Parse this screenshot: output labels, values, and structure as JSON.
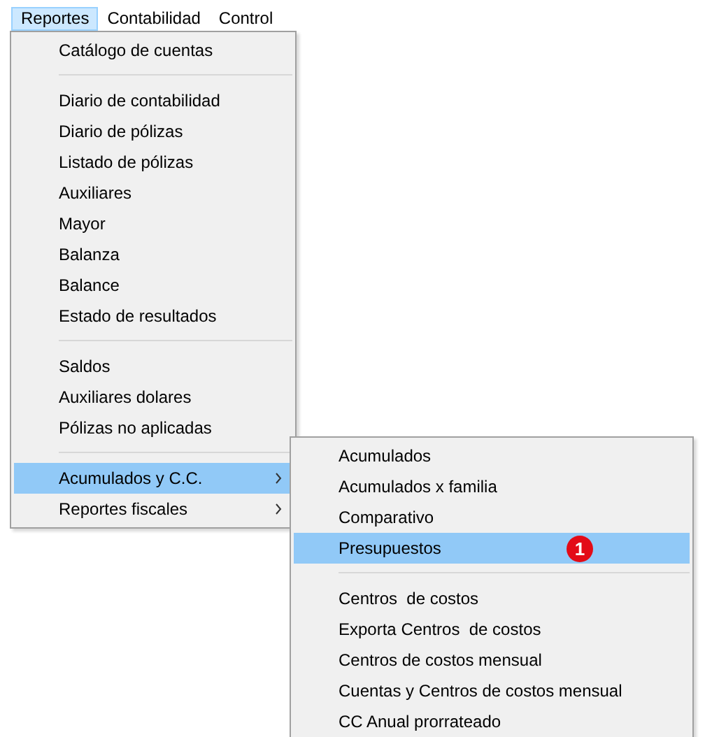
{
  "menubar": {
    "items": [
      {
        "label": "Reportes",
        "selected": true
      },
      {
        "label": "Contabilidad",
        "selected": false
      },
      {
        "label": "Control",
        "selected": false
      }
    ]
  },
  "menu": {
    "items": [
      {
        "kind": "item",
        "label": "Catálogo de cuentas",
        "selected": false,
        "has_submenu": false
      },
      {
        "kind": "separator"
      },
      {
        "kind": "item",
        "label": "Diario de contabilidad",
        "selected": false,
        "has_submenu": false
      },
      {
        "kind": "item",
        "label": "Diario de pólizas",
        "selected": false,
        "has_submenu": false
      },
      {
        "kind": "item",
        "label": "Listado de pólizas",
        "selected": false,
        "has_submenu": false
      },
      {
        "kind": "item",
        "label": "Auxiliares",
        "selected": false,
        "has_submenu": false
      },
      {
        "kind": "item",
        "label": "Mayor",
        "selected": false,
        "has_submenu": false
      },
      {
        "kind": "item",
        "label": "Balanza",
        "selected": false,
        "has_submenu": false
      },
      {
        "kind": "item",
        "label": "Balance",
        "selected": false,
        "has_submenu": false
      },
      {
        "kind": "item",
        "label": "Estado de resultados",
        "selected": false,
        "has_submenu": false
      },
      {
        "kind": "separator"
      },
      {
        "kind": "item",
        "label": "Saldos",
        "selected": false,
        "has_submenu": false
      },
      {
        "kind": "item",
        "label": "Auxiliares dolares",
        "selected": false,
        "has_submenu": false
      },
      {
        "kind": "item",
        "label": "Pólizas no aplicadas",
        "selected": false,
        "has_submenu": false
      },
      {
        "kind": "separator"
      },
      {
        "kind": "item",
        "label": "Acumulados y C.C.",
        "selected": true,
        "has_submenu": true
      },
      {
        "kind": "item",
        "label": "Reportes fiscales",
        "selected": false,
        "has_submenu": true
      }
    ]
  },
  "submenu": {
    "items": [
      {
        "kind": "item",
        "label": "Acumulados",
        "selected": false,
        "has_submenu": false
      },
      {
        "kind": "item",
        "label": "Acumulados x familia",
        "selected": false,
        "has_submenu": false
      },
      {
        "kind": "item",
        "label": "Comparativo",
        "selected": false,
        "has_submenu": false
      },
      {
        "kind": "item",
        "label": "Presupuestos",
        "selected": true,
        "has_submenu": false,
        "badge": "1"
      },
      {
        "kind": "separator"
      },
      {
        "kind": "item",
        "label": "Centros  de costos",
        "selected": false,
        "has_submenu": false
      },
      {
        "kind": "item",
        "label": "Exporta Centros  de costos",
        "selected": false,
        "has_submenu": false
      },
      {
        "kind": "item",
        "label": "Centros de costos mensual",
        "selected": false,
        "has_submenu": false
      },
      {
        "kind": "item",
        "label": "Cuentas y Centros de costos mensual",
        "selected": false,
        "has_submenu": false
      },
      {
        "kind": "item",
        "label": "CC Anual prorrateado",
        "selected": false,
        "has_submenu": false
      }
    ]
  }
}
